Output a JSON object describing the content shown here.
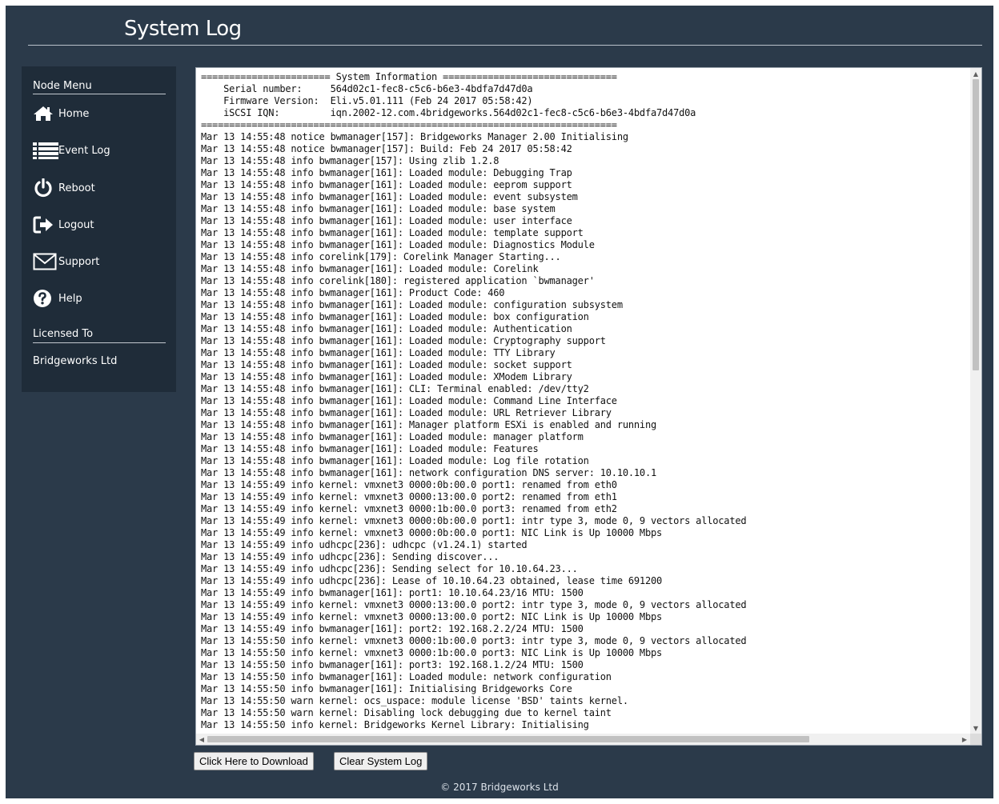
{
  "page": {
    "title": "System Log"
  },
  "sidebar": {
    "menu_heading": "Node Menu",
    "items": [
      {
        "label": "Home",
        "icon": "home-icon"
      },
      {
        "label": "Event Log",
        "icon": "list-icon"
      },
      {
        "label": "Reboot",
        "icon": "power-icon"
      },
      {
        "label": "Logout",
        "icon": "logout-icon"
      },
      {
        "label": "Support",
        "icon": "envelope-icon"
      },
      {
        "label": "Help",
        "icon": "question-icon"
      }
    ],
    "license_heading": "Licensed To",
    "licensee": "Bridgeworks Ltd"
  },
  "log": {
    "text": "======================= System Information ===============================\n    Serial number:     564d02c1-fec8-c5c6-b6e3-4bdfa7d47d0a\n    Firmware Version:  Eli.v5.01.111 (Feb 24 2017 05:58:42)\n    iSCSI IQN:         iqn.2002-12.com.4bridgeworks.564d02c1-fec8-c5c6-b6e3-4bdfa7d47d0a\n==========================================================================\nMar 13 14:55:48 notice bwmanager[157]: Bridgeworks Manager 2.00 Initialising\nMar 13 14:55:48 notice bwmanager[157]: Build: Feb 24 2017 05:58:42\nMar 13 14:55:48 info bwmanager[157]: Using zlib 1.2.8\nMar 13 14:55:48 info bwmanager[161]: Loaded module: Debugging Trap\nMar 13 14:55:48 info bwmanager[161]: Loaded module: eeprom support\nMar 13 14:55:48 info bwmanager[161]: Loaded module: event subsystem\nMar 13 14:55:48 info bwmanager[161]: Loaded module: base system\nMar 13 14:55:48 info bwmanager[161]: Loaded module: user interface\nMar 13 14:55:48 info bwmanager[161]: Loaded module: template support\nMar 13 14:55:48 info bwmanager[161]: Loaded module: Diagnostics Module\nMar 13 14:55:48 info corelink[179]: Corelink Manager Starting...\nMar 13 14:55:48 info bwmanager[161]: Loaded module: Corelink\nMar 13 14:55:48 info corelink[180]: registered application `bwmanager'\nMar 13 14:55:48 info bwmanager[161]: Product Code: 460\nMar 13 14:55:48 info bwmanager[161]: Loaded module: configuration subsystem\nMar 13 14:55:48 info bwmanager[161]: Loaded module: box configuration\nMar 13 14:55:48 info bwmanager[161]: Loaded module: Authentication\nMar 13 14:55:48 info bwmanager[161]: Loaded module: Cryptography support\nMar 13 14:55:48 info bwmanager[161]: Loaded module: TTY Library\nMar 13 14:55:48 info bwmanager[161]: Loaded module: socket support\nMar 13 14:55:48 info bwmanager[161]: Loaded module: XModem Library\nMar 13 14:55:48 info bwmanager[161]: CLI: Terminal enabled: /dev/tty2\nMar 13 14:55:48 info bwmanager[161]: Loaded module: Command Line Interface\nMar 13 14:55:48 info bwmanager[161]: Loaded module: URL Retriever Library\nMar 13 14:55:48 info bwmanager[161]: Manager platform ESXi is enabled and running\nMar 13 14:55:48 info bwmanager[161]: Loaded module: manager platform\nMar 13 14:55:48 info bwmanager[161]: Loaded module: Features\nMar 13 14:55:48 info bwmanager[161]: Loaded module: Log file rotation\nMar 13 14:55:48 info bwmanager[161]: network configuration DNS server: 10.10.10.1\nMar 13 14:55:49 info kernel: vmxnet3 0000:0b:00.0 port1: renamed from eth0\nMar 13 14:55:49 info kernel: vmxnet3 0000:13:00.0 port2: renamed from eth1\nMar 13 14:55:49 info kernel: vmxnet3 0000:1b:00.0 port3: renamed from eth2\nMar 13 14:55:49 info kernel: vmxnet3 0000:0b:00.0 port1: intr type 3, mode 0, 9 vectors allocated\nMar 13 14:55:49 info kernel: vmxnet3 0000:0b:00.0 port1: NIC Link is Up 10000 Mbps\nMar 13 14:55:49 info udhcpc[236]: udhcpc (v1.24.1) started\nMar 13 14:55:49 info udhcpc[236]: Sending discover...\nMar 13 14:55:49 info udhcpc[236]: Sending select for 10.10.64.23...\nMar 13 14:55:49 info udhcpc[236]: Lease of 10.10.64.23 obtained, lease time 691200\nMar 13 14:55:49 info bwmanager[161]: port1: 10.10.64.23/16 MTU: 1500\nMar 13 14:55:49 info kernel: vmxnet3 0000:13:00.0 port2: intr type 3, mode 0, 9 vectors allocated\nMar 13 14:55:49 info kernel: vmxnet3 0000:13:00.0 port2: NIC Link is Up 10000 Mbps\nMar 13 14:55:49 info bwmanager[161]: port2: 192.168.2.2/24 MTU: 1500\nMar 13 14:55:50 info kernel: vmxnet3 0000:1b:00.0 port3: intr type 3, mode 0, 9 vectors allocated\nMar 13 14:55:50 info kernel: vmxnet3 0000:1b:00.0 port3: NIC Link is Up 10000 Mbps\nMar 13 14:55:50 info bwmanager[161]: port3: 192.168.1.2/24 MTU: 1500\nMar 13 14:55:50 info bwmanager[161]: Loaded module: network configuration\nMar 13 14:55:50 info bwmanager[161]: Initialising Bridgeworks Core\nMar 13 14:55:50 warn kernel: ocs_uspace: module license 'BSD' taints kernel.\nMar 13 14:55:50 warn kernel: Disabling lock debugging due to kernel taint\nMar 13 14:55:50 info kernel: Bridgeworks Kernel Library: Initialising"
  },
  "actions": {
    "download_label": "Click Here to Download",
    "clear_label": "Clear System Log"
  },
  "footer": {
    "copyright": "© 2017 Bridgeworks Ltd"
  },
  "colors": {
    "background": "#2b3a4a",
    "sidebar": "#1f2c39",
    "text": "#ffffff"
  }
}
